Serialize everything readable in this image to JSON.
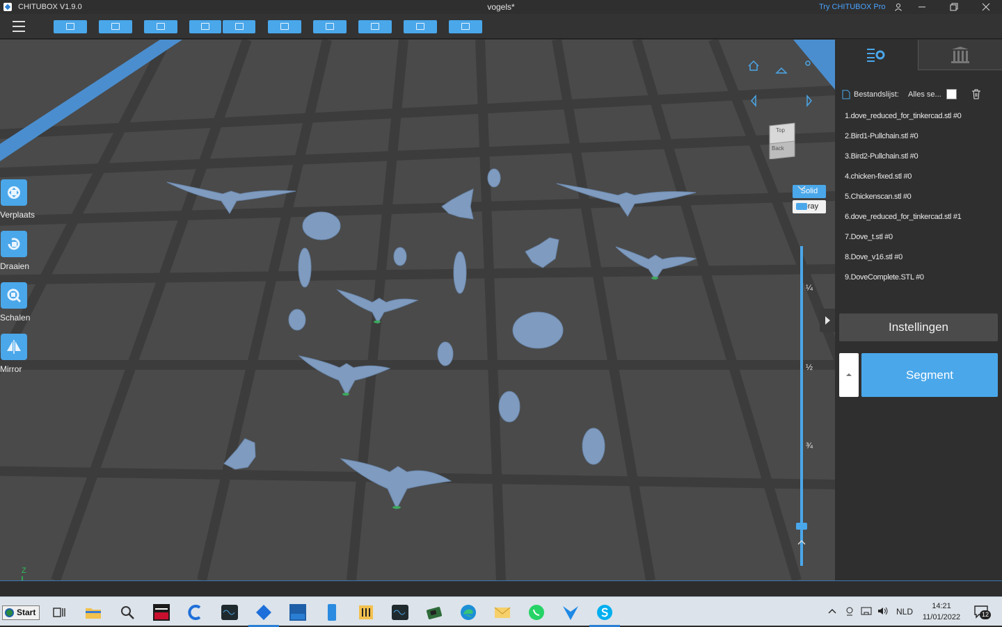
{
  "titlebar": {
    "app_name": "CHITUBOX V1.9.0",
    "document_title": "vogels*",
    "try_pro": "Try CHITUBOX Pro",
    "controls": [
      "user-icon",
      "minimize-icon",
      "restore-icon",
      "close-icon"
    ]
  },
  "toolbar": {
    "buttons": [
      "open-file-icon",
      "save-icon",
      "import-icon",
      "undo-icon",
      "redo-icon",
      "layout-icon",
      "arrange-icon",
      "support-icon",
      "hollow-icon",
      "slice-icon"
    ]
  },
  "left_tools": [
    {
      "name": "move",
      "label": "Verplaats",
      "icon": "move-icon"
    },
    {
      "name": "rotate",
      "label": "Draaien",
      "icon": "rotate-icon"
    },
    {
      "name": "scale",
      "label": "Schalen",
      "icon": "scale-icon"
    },
    {
      "name": "mirror",
      "label": "Mirror",
      "icon": "mirror-icon"
    }
  ],
  "view": {
    "cube_top": "Top",
    "cube_back": "Back",
    "solid_label": "Solid",
    "xray_label": "X-ray",
    "selected_mode": "Solid"
  },
  "layer_slider": {
    "fractions": [
      "¼",
      "½",
      "¾"
    ]
  },
  "right_panel": {
    "file_list_label": "Bestandslijst:",
    "select_all_label": "Alles se...",
    "files": [
      "1.dove_reduced_for_tinkercad.stl #0",
      "2.Bird1-Pullchain.stl #0",
      "3.Bird2-Pullchain.stl #0",
      "4.chicken-fixed.stl #0",
      "5.Chickenscan.stl #0",
      "6.dove_reduced_for_tinkercad.stl #1",
      "7.Dove_t.stl #0",
      "8.Dove_v16.stl #0",
      "9.DoveComplete.STL #0"
    ],
    "settings_button": "Instellingen",
    "segment_button": "Segment"
  },
  "axes": {
    "x": "X",
    "y": "Y",
    "z": "Z"
  },
  "taskbar": {
    "start_label": "Start",
    "apps": [
      "task-view-icon",
      "file-explorer-icon",
      "search-icon",
      "pickit-icon",
      "ccleaner-icon",
      "audio-app-icon",
      "chitubox-icon",
      "esu-app-icon",
      "phone-app-icon",
      "hardware-app-icon",
      "audio-app-2-icon",
      "raspberry-icon",
      "edge-icon",
      "mail-icon",
      "whatsapp-icon",
      "vpn-icon",
      "skype-icon"
    ],
    "active_app": "chitubox-icon",
    "language": "NLD",
    "time": "14:21",
    "date": "11/01/2022",
    "notification_count": "12"
  },
  "colors": {
    "accent": "#4aa7ea",
    "viewport_bg": "#4a4a4a",
    "panel_bg": "#2f2f2f",
    "model": "#7f9bbf"
  }
}
